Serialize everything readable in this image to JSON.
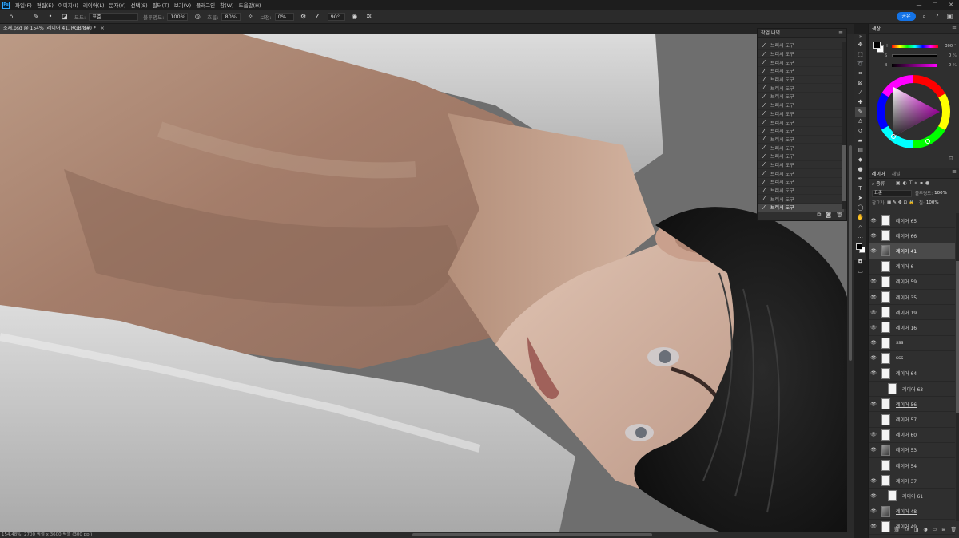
{
  "menubar": {
    "logo": "Ps",
    "items": [
      "파일(F)",
      "편집(E)",
      "이미지(I)",
      "레이어(L)",
      "문자(Y)",
      "선택(S)",
      "필터(T)",
      "보기(V)",
      "플러그인",
      "창(W)",
      "도움말(H)"
    ],
    "window": {
      "minimize": "—",
      "maximize": "☐",
      "close": "✕"
    }
  },
  "options": {
    "mode_label": "모드:",
    "mode_value": "표준",
    "opacity_label": "불투명도:",
    "opacity_value": "100%",
    "flow_label": "흐름:",
    "flow_value": "80%",
    "smoothing_label": "보정:",
    "smoothing_value": "0%",
    "angle_value": "90°",
    "share_label": "공유"
  },
  "document": {
    "tab_title": "소재.psd @ 154% (레이어 41, RGB/8#) *",
    "zoom": "154.48%",
    "info": "2700 픽셀 x 3600 픽셀 (300 ppi)"
  },
  "history": {
    "title": "작업 내역",
    "step_label": "브러시 도구",
    "step_count": 20
  },
  "color": {
    "title": "색상",
    "slider_h_label": "H",
    "slider_h_value": "300",
    "slider_s_label": "S",
    "slider_s_value": "0",
    "slider_b_label": "B",
    "slider_b_value": "0",
    "percent": "%",
    "accent": "#1473e6",
    "hue_color": "#ff00ff"
  },
  "layers": {
    "tabs": [
      "레이어",
      "채널"
    ],
    "filter_kind": "종류",
    "blend_mode": "표준",
    "opacity_label": "불투명도:",
    "opacity_value": "100%",
    "lock_label": "잠그기:",
    "fill_label": "칠:",
    "fill_value": "100%",
    "items": [
      {
        "name": "레이어 65",
        "visible": true,
        "selected": false,
        "clipped": false,
        "underline": false,
        "dark": false
      },
      {
        "name": "레이어 66",
        "visible": true,
        "selected": false,
        "clipped": false,
        "underline": false,
        "dark": false
      },
      {
        "name": "레이어 41",
        "visible": true,
        "selected": true,
        "clipped": false,
        "underline": false,
        "dark": true
      },
      {
        "name": "레이어 6",
        "visible": false,
        "selected": false,
        "clipped": false,
        "underline": false,
        "dark": false
      },
      {
        "name": "레이어 59",
        "visible": true,
        "selected": false,
        "clipped": false,
        "underline": false,
        "dark": false
      },
      {
        "name": "레이어 35",
        "visible": true,
        "selected": false,
        "clipped": false,
        "underline": false,
        "dark": false
      },
      {
        "name": "레이어 19",
        "visible": true,
        "selected": false,
        "clipped": false,
        "underline": false,
        "dark": false
      },
      {
        "name": "레이어 16",
        "visible": true,
        "selected": false,
        "clipped": false,
        "underline": false,
        "dark": false
      },
      {
        "name": "sss",
        "visible": true,
        "selected": false,
        "clipped": false,
        "underline": false,
        "dark": false
      },
      {
        "name": "sss",
        "visible": true,
        "selected": false,
        "clipped": false,
        "underline": false,
        "dark": false
      },
      {
        "name": "레이어 64",
        "visible": true,
        "selected": false,
        "clipped": false,
        "underline": false,
        "dark": false
      },
      {
        "name": "레이어 63",
        "visible": false,
        "selected": false,
        "clipped": true,
        "underline": false,
        "dark": false
      },
      {
        "name": "레이어 56",
        "visible": true,
        "selected": false,
        "clipped": false,
        "underline": true,
        "dark": false
      },
      {
        "name": "레이어 57",
        "visible": false,
        "selected": false,
        "clipped": false,
        "underline": false,
        "dark": false
      },
      {
        "name": "레이어 60",
        "visible": true,
        "selected": false,
        "clipped": false,
        "underline": false,
        "dark": false
      },
      {
        "name": "레이어 53",
        "visible": true,
        "selected": false,
        "clipped": false,
        "underline": false,
        "dark": true
      },
      {
        "name": "레이어 54",
        "visible": false,
        "selected": false,
        "clipped": false,
        "underline": false,
        "dark": false
      },
      {
        "name": "레이어 37",
        "visible": true,
        "selected": false,
        "clipped": false,
        "underline": false,
        "dark": false
      },
      {
        "name": "레이어 61",
        "visible": true,
        "selected": false,
        "clipped": true,
        "underline": false,
        "dark": false
      },
      {
        "name": "레이어 48",
        "visible": true,
        "selected": false,
        "clipped": false,
        "underline": true,
        "dark": true
      },
      {
        "name": "레이어 49",
        "visible": true,
        "selected": false,
        "clipped": false,
        "underline": false,
        "dark": false
      }
    ]
  },
  "tools": [
    "move-tool",
    "marquee-tool",
    "lasso-tool",
    "magic-wand-tool",
    "crop-tool",
    "frame-tool",
    "eyedropper-tool",
    "healing-tool",
    "brush-tool",
    "stamp-tool",
    "history-brush-tool",
    "eraser-tool",
    "gradient-tool",
    "blur-tool",
    "dodge-tool",
    "pen-tool",
    "type-tool",
    "path-select-tool",
    "shape-tool",
    "hand-tool",
    "zoom-tool",
    "more-tools"
  ]
}
